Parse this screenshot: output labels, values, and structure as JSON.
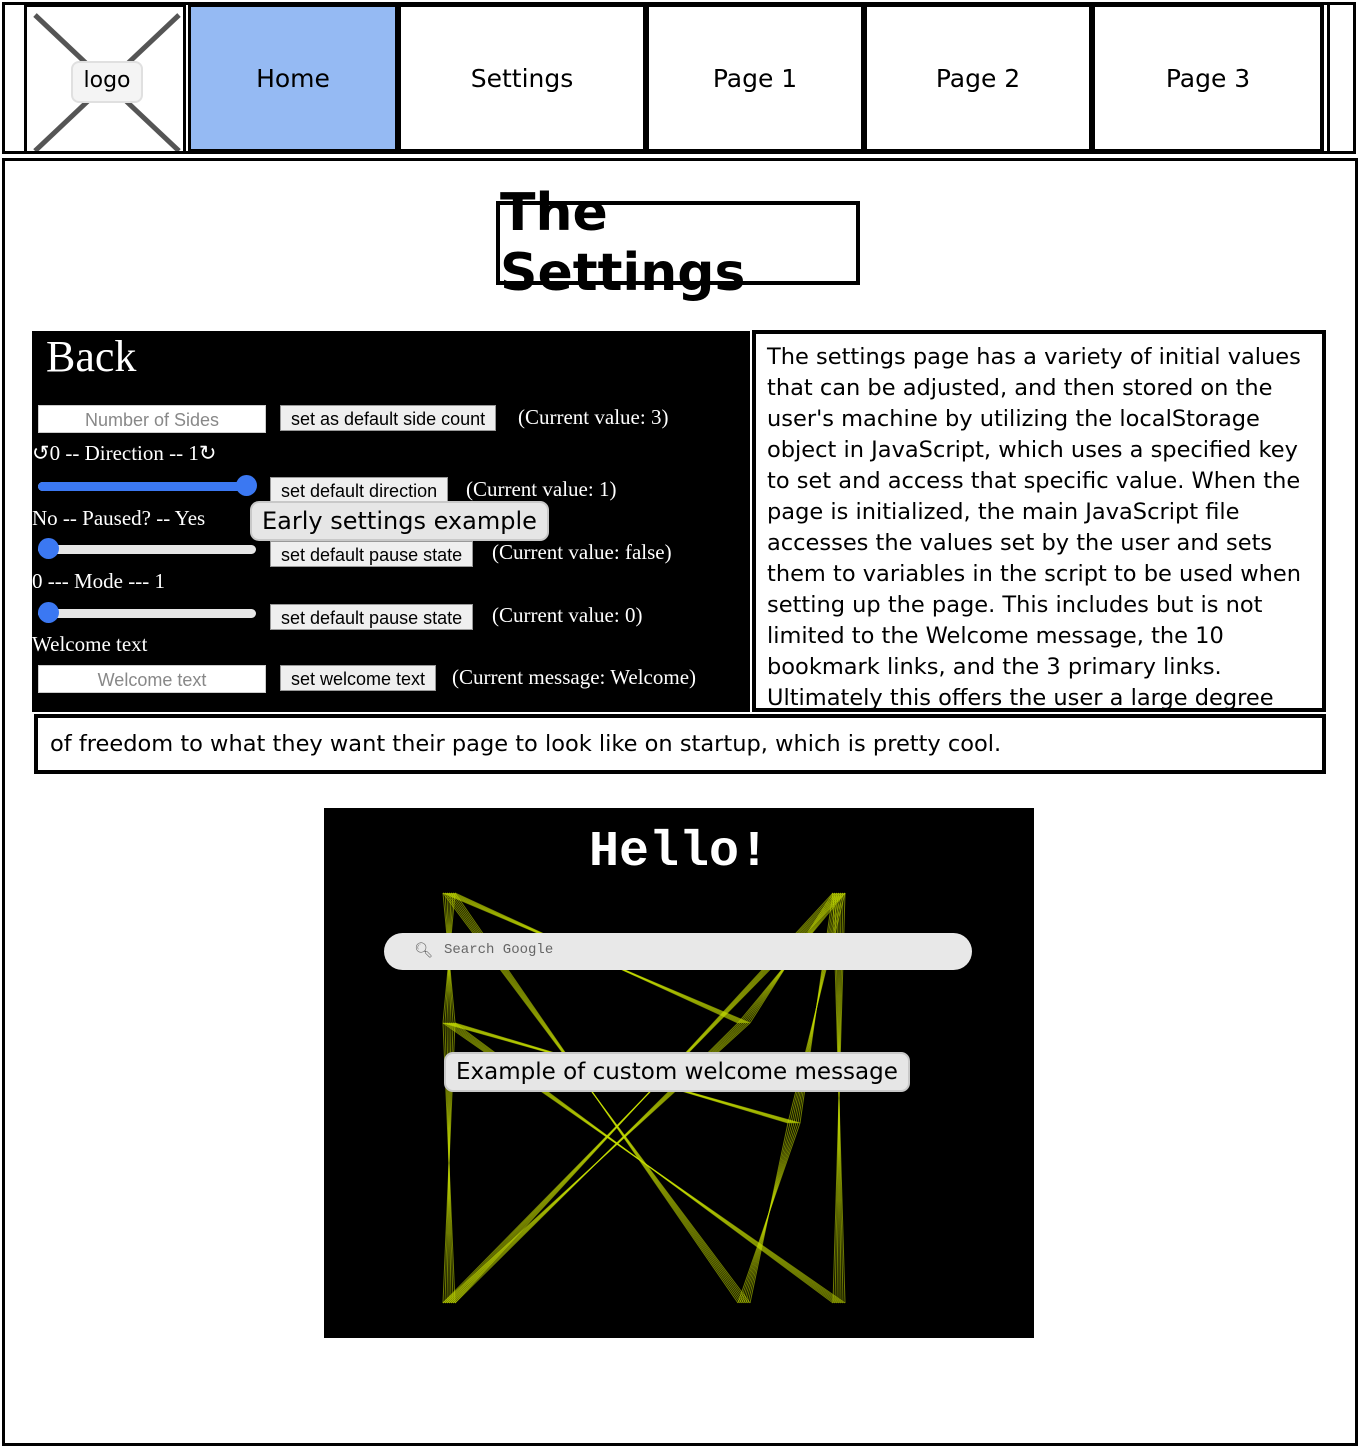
{
  "nav": {
    "logo_label": "logo",
    "items": [
      "Home",
      "Settings",
      "Page 1",
      "Page 2",
      "Page 3"
    ]
  },
  "title": "The Settings",
  "settings_screenshot": {
    "back": "Back",
    "sides_placeholder": "Number of Sides",
    "sides_button": "set as default side count",
    "sides_current": "(Current value: 3)",
    "direction_label": "↺0 -- Direction -- 1↻",
    "direction_button": "set default direction",
    "direction_current": "(Current value: 1)",
    "direction_value": 1,
    "paused_label": "No -- Paused? -- Yes",
    "paused_button": "set default pause state",
    "paused_current": "(Current value: false)",
    "paused_value": 0,
    "mode_label": "0 --- Mode --- 1",
    "mode_button": "set default pause state",
    "mode_current": "(Current value: 0)",
    "mode_value": 0,
    "welcome_label": "Welcome text",
    "welcome_placeholder": "Welcome text",
    "welcome_button": "set welcome text",
    "welcome_current": "(Current message: Welcome)",
    "caption": "Early settings example"
  },
  "description": "The settings page has a variety of initial values that can be adjusted, and then stored on the user's machine by utilizing the localStorage object in JavaScript, which uses a specified key to set and access that specific value. When the page is initialized, the main JavaScript file accesses the values set by the user and sets them to variables in the script to be used when setting up the page. This includes but is not limited to the Welcome message, the 10 bookmark links, and the 3 primary links. Ultimately this offers the user a large degree",
  "description_continued": "of freedom to what they want their page to look like on startup, which is pretty cool.",
  "welcome_screenshot": {
    "hello": "Hello!",
    "search_placeholder": "Search Google",
    "caption": "Example of custom welcome message",
    "line_color": "#c8e000"
  },
  "colors": {
    "active_nav": "#95baf3",
    "slider": "#3b78f2"
  }
}
